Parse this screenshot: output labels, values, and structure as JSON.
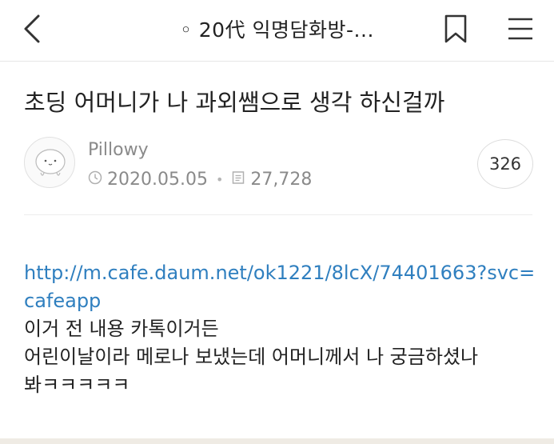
{
  "header": {
    "title": "◦ 20代 익명담화방-...",
    "back_icon": "chevron-left-icon",
    "bookmark_icon": "bookmark-icon",
    "menu_icon": "hamburger-menu-icon"
  },
  "post": {
    "title": "초딩 어머니가 나 과외쌤으로 생각 하신걸까",
    "author": "Pillowy",
    "date": "2020.05.05",
    "views": "27,728",
    "comment_count": "326"
  },
  "content": {
    "link": "http://m.cafe.daum.net/ok1221/8lcX/74401663?svc=cafeapp",
    "lines": [
      "이거 전 내용 카톡이거든",
      "어린이날이라 메로나 보냈는데 어머니께서 나 궁금하셨나",
      "봐ㅋㅋㅋㅋㅋ"
    ]
  },
  "colors": {
    "link": "#2f7fbf",
    "meta": "#8a8a8a"
  }
}
